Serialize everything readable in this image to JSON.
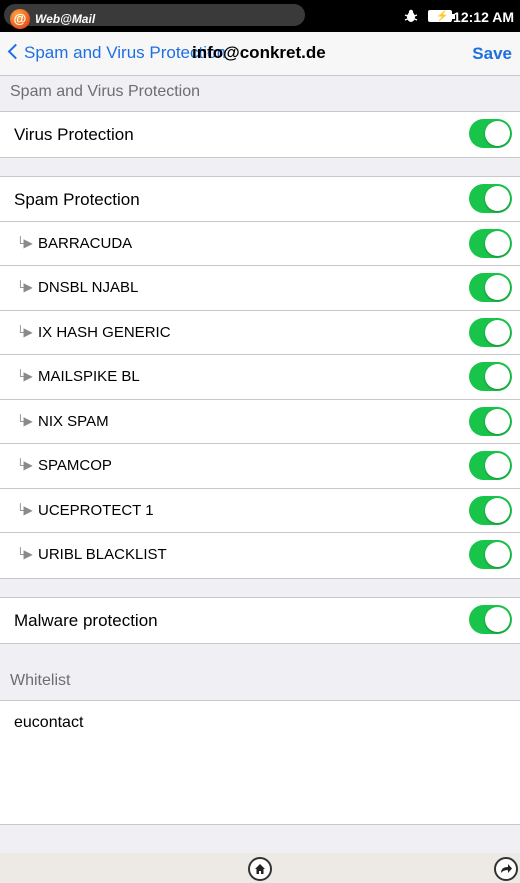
{
  "status_bar": {
    "app_name": "Web@Mail",
    "app_icon": "@",
    "time": "12:12 AM"
  },
  "nav": {
    "back_label": "Spam and Virus Protection",
    "title": "info@conkret.de",
    "save_label": "Save"
  },
  "section_protection": {
    "header": "Spam and Virus Protection",
    "virus_label": "Virus Protection",
    "virus_on": true
  },
  "spam": {
    "label": "Spam Protection",
    "on": true,
    "arrow": "└▶",
    "lists": [
      {
        "label": "BARRACUDA",
        "on": true
      },
      {
        "label": "DNSBL NJABL",
        "on": true
      },
      {
        "label": "IX HASH GENERIC",
        "on": true
      },
      {
        "label": "MAILSPIKE BL",
        "on": true
      },
      {
        "label": "NIX SPAM",
        "on": true
      },
      {
        "label": "SPAMCOP",
        "on": true
      },
      {
        "label": "UCEPROTECT 1",
        "on": true
      },
      {
        "label": "URIBL BLACKLIST",
        "on": true
      }
    ]
  },
  "malware": {
    "label": "Malware protection",
    "on": true
  },
  "whitelist": {
    "header": "Whitelist",
    "value": "eucontact"
  },
  "colors": {
    "accent": "#1f6fe0",
    "toggle_on": "#19c44a"
  }
}
